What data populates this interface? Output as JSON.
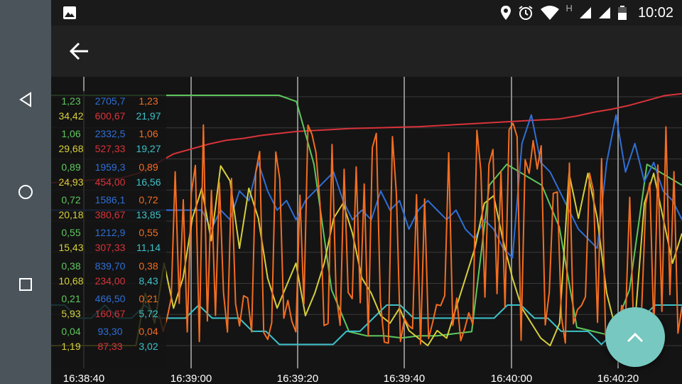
{
  "status_bar": {
    "time": "10:02",
    "icons": [
      "gallery-icon",
      "location-icon",
      "alarm-icon",
      "wifi-icon",
      "signal-icon",
      "battery-icon"
    ],
    "network_letter": "H"
  },
  "toolbar": {
    "back_icon": "arrow-left-icon"
  },
  "nav": {
    "icons": [
      "back-triangle-icon",
      "home-circle-icon",
      "recents-square-icon"
    ]
  },
  "colors": {
    "green": "#5ec75e",
    "yellow": "#d6cf3c",
    "blue": "#2f6fd6",
    "red": "#d8333a",
    "orange": "#f36d21",
    "cyan": "#3cc1c9",
    "fab": "#76c8c0"
  },
  "legend": {
    "columns": [
      {
        "series": [
          "green",
          "yellow"
        ],
        "values": [
          [
            "1,23",
            "34,42"
          ],
          [
            "1,06",
            "29,68"
          ],
          [
            "0,89",
            "24,93"
          ],
          [
            "0,72",
            "20,18"
          ],
          [
            "0,55",
            "15,43"
          ],
          [
            "0,38",
            "10,68"
          ],
          [
            "0,21",
            "5,93"
          ],
          [
            "0,04",
            "1,19"
          ]
        ]
      },
      {
        "series": [
          "blue",
          "red"
        ],
        "values": [
          [
            "2705,7",
            "600,67"
          ],
          [
            "2332,5",
            "527,33"
          ],
          [
            "1959,3",
            "454,00"
          ],
          [
            "1586,1",
            "380,67"
          ],
          [
            "1212,9",
            "307,33"
          ],
          [
            "839,70",
            "234,00"
          ],
          [
            "466,50",
            "160,67"
          ],
          [
            "93,30",
            "87,33"
          ]
        ]
      },
      {
        "series": [
          "orange",
          "cyan"
        ],
        "values": [
          [
            "1,23",
            "21,97"
          ],
          [
            "1,06",
            "19,27"
          ],
          [
            "0,89",
            "16,56"
          ],
          [
            "0,72",
            "13,85"
          ],
          [
            "0,55",
            "11,14"
          ],
          [
            "0,38",
            "8,43"
          ],
          [
            "0,21",
            "5,72"
          ],
          [
            "0,04",
            "3,02"
          ]
        ]
      }
    ]
  },
  "time_axis": [
    "16:38:40",
    "16:39:00",
    "16:39:20",
    "16:39:40",
    "16:40:00",
    "16:40:20"
  ],
  "fab": {
    "icon": "chevron-up-icon"
  },
  "chart_data": {
    "type": "line",
    "x_ticks": [
      "16:38:40",
      "16:39:00",
      "16:39:20",
      "16:39:40",
      "16:40:00",
      "16:40:20"
    ],
    "series": [
      {
        "color": "green",
        "scale": [
          1.23,
          0.04
        ],
        "values": [
          1.23,
          1.23,
          1.23,
          1.23,
          1.23,
          1.23,
          1.23,
          1.23,
          1.23,
          1.23,
          1.23,
          1.23,
          1.23,
          1.23,
          1.2,
          0.9,
          0.3,
          0.1,
          0.08,
          0.08,
          0.07,
          0.08,
          0.08,
          0.09,
          0.1,
          0.8,
          0.9,
          0.85,
          0.8,
          0.6,
          0.12,
          0.1,
          0.08,
          0.3,
          0.9,
          0.85,
          0.8
        ]
      },
      {
        "color": "yellow",
        "scale": [
          34.42,
          1.19
        ],
        "values": [
          1,
          1,
          1,
          1,
          1,
          1,
          1,
          1,
          1,
          1,
          8,
          4,
          12,
          6,
          10,
          18,
          22,
          15,
          25,
          23,
          14,
          22,
          18,
          10,
          6,
          9,
          12,
          5,
          8,
          12,
          18,
          20,
          16,
          10,
          8,
          5,
          4,
          6,
          3,
          2,
          1,
          3,
          2,
          6,
          10,
          14,
          20,
          21,
          15,
          10,
          6,
          4,
          2,
          1,
          4,
          24,
          18,
          24,
          18,
          8,
          3,
          2,
          4,
          20,
          24,
          18,
          12,
          16
        ]
      },
      {
        "color": "blue",
        "scale": [
          2705.7,
          93.3
        ],
        "values": [
          1500,
          1500,
          1500,
          1500,
          1500,
          1500,
          1500,
          1500,
          1500,
          1500,
          1500,
          1500,
          1500,
          1500,
          1500,
          1500,
          1500,
          1300,
          1500,
          1400,
          1700,
          1600,
          2000,
          1700,
          1500,
          1600,
          1400,
          1600,
          1700,
          1800,
          1900,
          1600,
          1400,
          1500,
          1400,
          1700,
          1500,
          1600,
          1300,
          1500,
          1600,
          1500,
          1400,
          1500,
          1300,
          1200,
          1400,
          1300,
          1100,
          1000,
          2200,
          2500,
          2000,
          1900,
          1700,
          1500,
          1300,
          1200,
          1100,
          2000,
          2500,
          1900,
          2200,
          1800,
          2000,
          1700,
          1600,
          1400
        ]
      },
      {
        "color": "red",
        "scale": [
          600.67,
          87.33
        ],
        "values": [
          420,
          423,
          425,
          428,
          430,
          440,
          460,
          480,
          490,
          500,
          508,
          512,
          518,
          522,
          526,
          528,
          530,
          532,
          533,
          534,
          535,
          536,
          538,
          540,
          542,
          544,
          546,
          548,
          550,
          552,
          558,
          566,
          572,
          580,
          590,
          600,
          604
        ]
      },
      {
        "color": "cyan",
        "scale": [
          21.97,
          3.02
        ],
        "values": [
          6,
          6,
          5,
          5,
          6,
          5,
          5,
          6,
          5,
          5,
          5,
          6,
          5,
          5,
          5,
          4,
          4,
          3,
          3,
          3,
          3,
          3,
          4,
          4,
          5,
          6,
          6,
          5,
          5,
          5,
          5,
          5,
          5,
          5,
          6,
          6,
          5,
          5,
          4,
          4,
          4,
          3,
          4,
          4,
          5,
          6,
          6,
          6
        ]
      }
    ]
  }
}
